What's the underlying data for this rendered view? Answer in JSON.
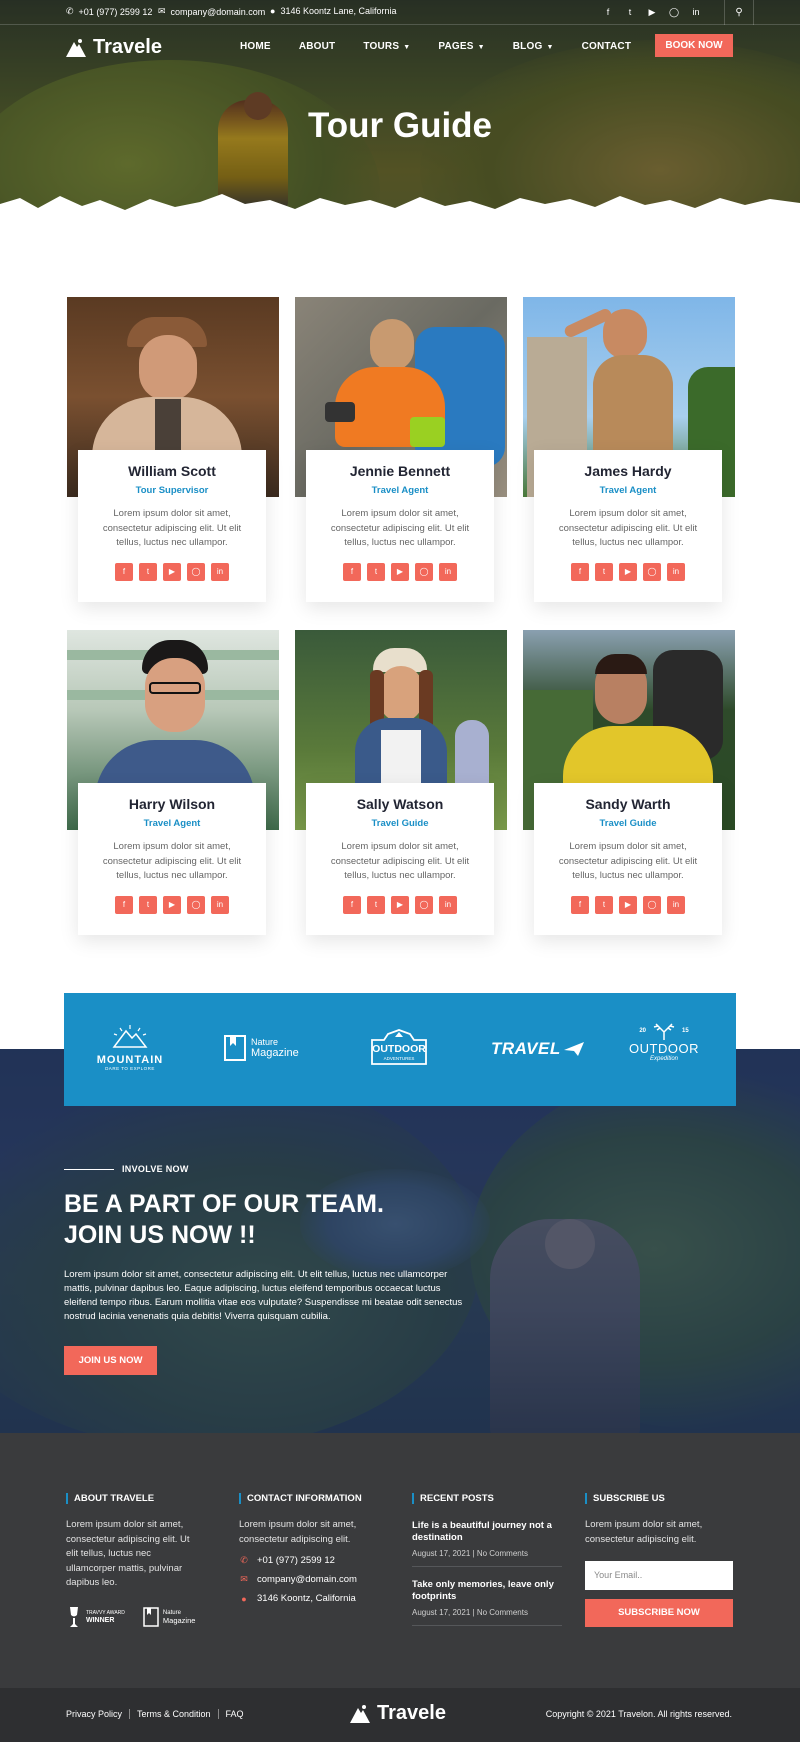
{
  "topbar": {
    "phone": "+01 (977) 2599 12",
    "email": "company@domain.com",
    "address": "3146 Koontz Lane, California",
    "social_icons": [
      "facebook-icon",
      "twitter-icon",
      "youtube-icon",
      "instagram-icon",
      "linkedin-icon"
    ]
  },
  "header": {
    "logo_text": "Travele",
    "nav": [
      "HOME",
      "ABOUT",
      "TOURS",
      "PAGES",
      "BLOG",
      "CONTACT"
    ],
    "book_button": "BOOK NOW"
  },
  "hero": {
    "title": "Tour Guide"
  },
  "team": {
    "description": "Lorem ipsum dolor sit amet, consectetur adipiscing elit. Ut elit tellus, luctus nec ullampor.",
    "members": [
      {
        "name": "William Scott",
        "role": "Tour Supervisor"
      },
      {
        "name": "Jennie Bennett",
        "role": "Travel Agent"
      },
      {
        "name": "James Hardy",
        "role": "Travel Agent"
      },
      {
        "name": "Harry Wilson",
        "role": "Travel Agent"
      },
      {
        "name": "Sally Watson",
        "role": "Travel Guide"
      },
      {
        "name": "Sandy Warth",
        "role": "Travel Guide"
      }
    ]
  },
  "brands": {
    "mountain": "MOUNTAIN",
    "mountain_sub": "DARE TO EXPLORE",
    "nature_1": "Nature",
    "nature_2": "Magazine",
    "outdoor_1": "OUTDOOR",
    "outdoor_1_sub": "ADVENTURES",
    "travel": "TRAVEL",
    "outdoor_2_year_left": "20",
    "outdoor_2_year_right": "15",
    "outdoor_2": "OUTDOOR",
    "outdoor_2_sub": "Expedition"
  },
  "involve": {
    "tag": "INVOLVE NOW",
    "title_line1": "BE A PART OF OUR TEAM.",
    "title_line2": "JOIN US NOW !!",
    "text": "Lorem ipsum dolor sit amet, consectetur adipiscing elit. Ut elit tellus, luctus nec ullamcorper mattis, pulvinar dapibus leo. Eaque adipiscing, luctus eleifend temporibus occaecat luctus eleifend tempo ribus. Earum mollitia vitae eos vulputate? Suspendisse mi beatae odit senectus nostrud lacinia venenatis quia debitis! Viverra quisquam cubilia.",
    "button": "JOIN US NOW"
  },
  "footer": {
    "about": {
      "heading": "ABOUT TRAVELE",
      "text": "Lorem ipsum dolor sit amet, consectetur adipiscing elit. Ut elit tellus, luctus nec ullamcorper mattis, pulvinar dapibus leo.",
      "award_1_line1": "TRAVVY AWARD",
      "award_1_line2": "WINNER",
      "award_2_line1": "Nature",
      "award_2_line2": "Magazine"
    },
    "contact": {
      "heading": "CONTACT INFORMATION",
      "text": "Lorem ipsum dolor sit amet, consectetur adipiscing elit.",
      "phone": "+01 (977) 2599 12",
      "email": "company@domain.com",
      "address": "3146 Koontz, California"
    },
    "recent": {
      "heading": "RECENT POSTS",
      "posts": [
        {
          "title": "Life is a beautiful journey not a destination",
          "date": "August 17, 2021",
          "comments": "No Comments"
        },
        {
          "title": "Take only memories, leave only footprints",
          "date": "August 17, 2021",
          "comments": "No Comments"
        }
      ]
    },
    "subscribe": {
      "heading": "SUBSCRIBE US",
      "text": "Lorem ipsum dolor sit amet, consectetur adipiscing elit.",
      "placeholder": "Your Email..",
      "button": "SUBSCRIBE NOW"
    },
    "bottom": {
      "links": [
        "Privacy Policy",
        "Terms & Condition",
        "FAQ"
      ],
      "logo_text": "Travele",
      "copyright": "Copyright © 2021 Travelon. All rights reserved."
    }
  },
  "colors": {
    "accent": "#f2685a",
    "primary": "#1a8fc6",
    "footer": "#3a3b3d"
  }
}
